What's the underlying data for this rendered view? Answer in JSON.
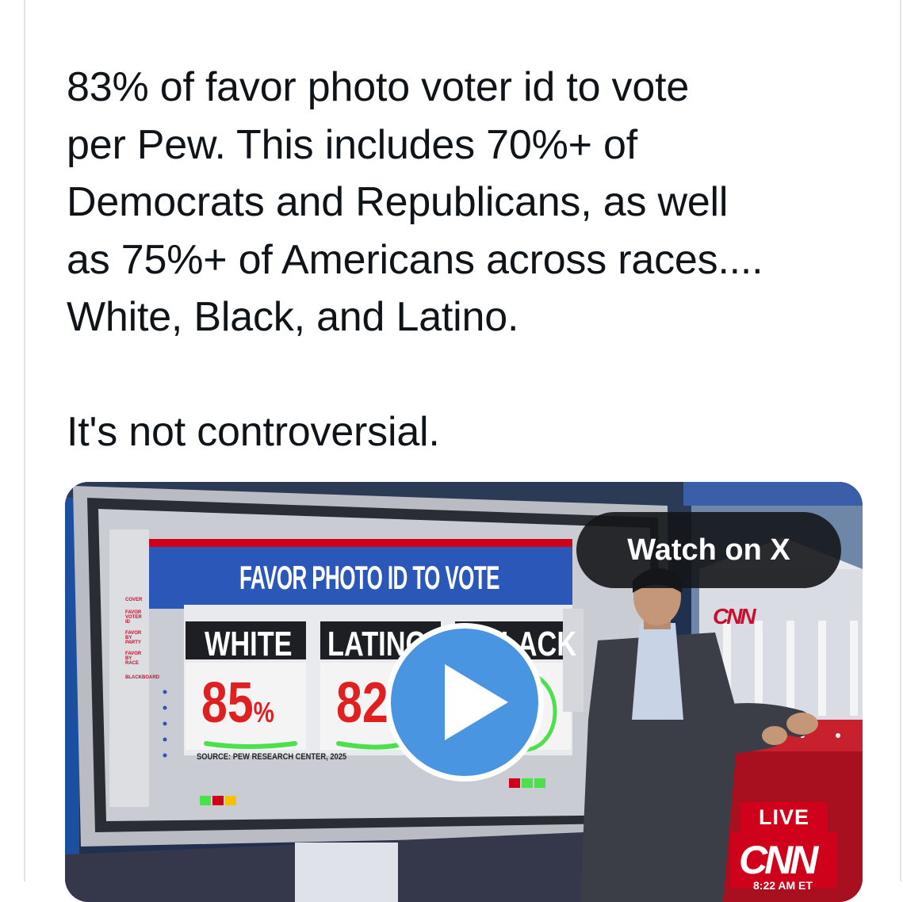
{
  "post": {
    "text": "83% of favor photo voter id to vote\nper Pew. This includes 70%+ of\nDemocrats and Republicans, as well\nas 75%+ of Americans across races....\nWhite, Black, and Latino.\n\nIt's not controversial."
  },
  "video": {
    "watch_label": "Watch on X",
    "screen": {
      "title": "FAVOR PHOTO ID TO VOTE",
      "columns": [
        "WHITE",
        "LATINO",
        "BLACK"
      ],
      "white_value": "85",
      "pct_sign": "%",
      "latino_value": "82",
      "source": "SOURCE: PEW RESEARCH CENTER, 2025",
      "menu": [
        "COVER",
        "FAVOR VOTER ID",
        "FAVOR BY PARTY",
        "FAVOR BY RACE",
        "BLACKBOARD"
      ]
    },
    "overlay": {
      "live": "LIVE",
      "network": "CNN",
      "time": "8:22 AM ET"
    }
  }
}
